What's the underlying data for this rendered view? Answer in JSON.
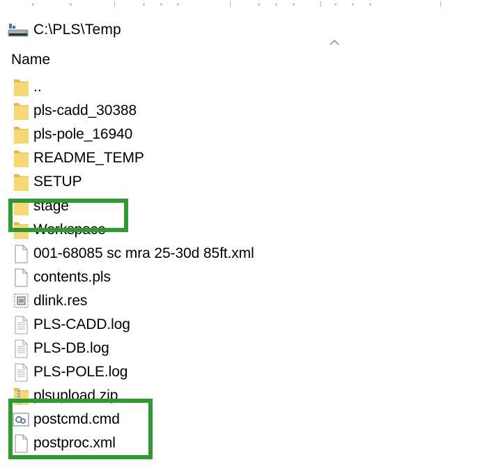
{
  "address_bar": {
    "path": "C:\\PLS\\Temp",
    "icon": "drive-icon"
  },
  "column_header": {
    "name": "Name",
    "sort_icon": "sort-ascending-icon"
  },
  "files": [
    {
      "name": "..",
      "type": "folder",
      "icon": "folder-icon"
    },
    {
      "name": "pls-cadd_30388",
      "type": "folder",
      "icon": "folder-icon"
    },
    {
      "name": "pls-pole_16940",
      "type": "folder",
      "icon": "folder-icon"
    },
    {
      "name": "README_TEMP",
      "type": "folder",
      "icon": "folder-icon"
    },
    {
      "name": "SETUP",
      "type": "folder",
      "icon": "folder-icon"
    },
    {
      "name": "stage",
      "type": "folder",
      "icon": "folder-icon",
      "highlighted": true
    },
    {
      "name": "Workspace",
      "type": "folder",
      "icon": "folder-icon"
    },
    {
      "name": "001-68085 sc mra 25-30d 85ft.xml",
      "type": "file",
      "icon": "blank-file-icon"
    },
    {
      "name": "contents.pls",
      "type": "file",
      "icon": "blank-file-icon"
    },
    {
      "name": "dlink.res",
      "type": "file",
      "icon": "resource-file-icon"
    },
    {
      "name": "PLS-CADD.log",
      "type": "file",
      "icon": "text-file-icon"
    },
    {
      "name": "PLS-DB.log",
      "type": "file",
      "icon": "text-file-icon"
    },
    {
      "name": "PLS-POLE.log",
      "type": "file",
      "icon": "text-file-icon"
    },
    {
      "name": "plsupload.zip",
      "type": "file",
      "icon": "zip-folder-icon",
      "highlighted": true
    },
    {
      "name": "postcmd.cmd",
      "type": "file",
      "icon": "cmd-file-icon",
      "highlighted": true
    },
    {
      "name": "postproc.xml",
      "type": "file",
      "icon": "blank-file-icon"
    }
  ],
  "colors": {
    "highlight_border": "#2f9a2f",
    "folder_yellow": "#f8d775"
  }
}
